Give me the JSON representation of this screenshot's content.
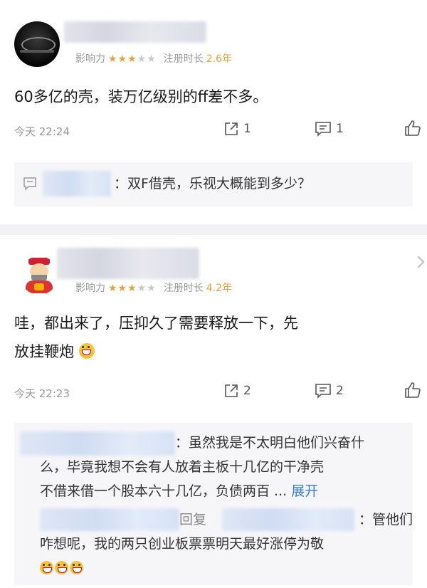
{
  "comments": [
    {
      "influence_label": "影响力",
      "stars_filled": "★★★",
      "stars_empty": "★★",
      "register_label": "注册时长",
      "register_years": "2.6年",
      "body": "60多亿的壳，装万亿级别的ff差不多。",
      "time": "今天 22:24",
      "share_count": "1",
      "comment_count": "1",
      "reply_preview": "：双F借壳，乐视大概能到多少？"
    },
    {
      "influence_label": "影响力",
      "stars_filled": "★★★",
      "stars_empty": "★★",
      "register_label": "注册时长",
      "register_years": "4.2年",
      "body_line1": "哇，都出来了，压抑久了需要释放一下，先",
      "body_line2": "放挂鞭炮",
      "time": "今天 22:23",
      "share_count": "2",
      "comment_count": "2",
      "reply1_line1": "：虽然我是不太明白他们兴奋什",
      "reply1_line2": "么，毕竟我想不会有人放着主板十几亿的干净壳",
      "reply1_line3": "不借来借一个股本六十几亿，负债两百 ...",
      "expand_label": "展开",
      "reply2_prefix": "回复",
      "reply2_line1": "：管他们",
      "reply2_line2": "咋想呢，我的两只创业板票票明天最好涨停为敬"
    }
  ]
}
